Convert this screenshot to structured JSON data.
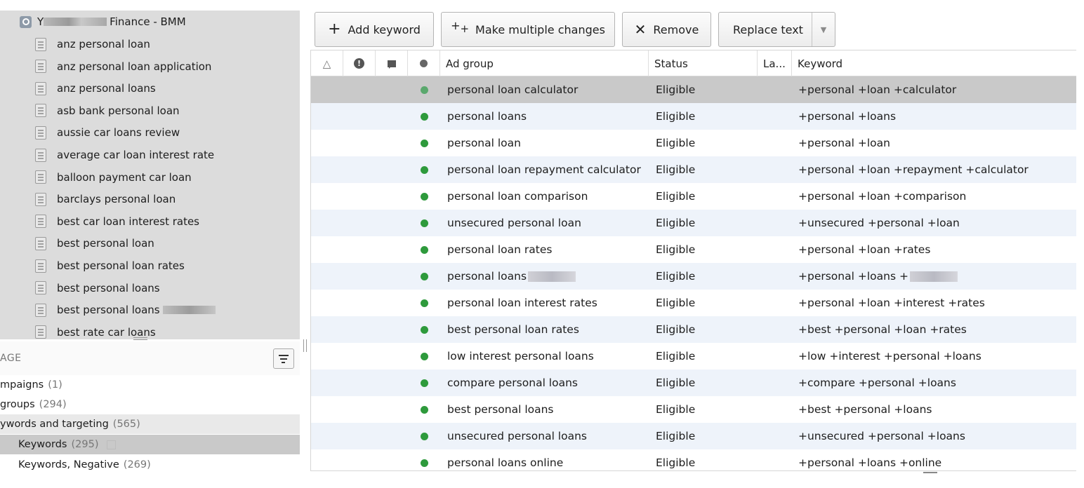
{
  "tree": {
    "root_label": "Finance - BMM",
    "root_prefix": "Y",
    "items": [
      {
        "label": "anz personal loan"
      },
      {
        "label": "anz personal loan application"
      },
      {
        "label": "anz personal loans"
      },
      {
        "label": "asb bank personal loan"
      },
      {
        "label": "aussie car loans review"
      },
      {
        "label": "average car loan interest rate"
      },
      {
        "label": "balloon payment car loan"
      },
      {
        "label": "barclays personal loan"
      },
      {
        "label": "best car loan interest rates"
      },
      {
        "label": "best personal loan"
      },
      {
        "label": "best personal loan rates"
      },
      {
        "label": "best personal loans"
      },
      {
        "label": "best personal loans"
      },
      {
        "label": "best rate car loans"
      }
    ]
  },
  "manage": {
    "title": "AGE",
    "rows": [
      {
        "label": "mpaigns",
        "count": "(1)"
      },
      {
        "label": "groups",
        "count": "(294)"
      },
      {
        "label": "ywords and targeting",
        "count": "(565)"
      },
      {
        "label": "Keywords",
        "count": "(295)"
      },
      {
        "label": "Keywords, Negative",
        "count": "(269)"
      }
    ]
  },
  "toolbar": {
    "add_keyword": "Add keyword",
    "multiple_changes": "Make multiple changes",
    "remove": "Remove",
    "replace_text": "Replace text"
  },
  "grid": {
    "headers": {
      "ad_group": "Ad group",
      "status": "Status",
      "label": "La...",
      "keyword": "Keyword"
    },
    "rows": [
      {
        "ad_group": "personal loan calculator",
        "status": "Eligible",
        "keyword": "+personal +loan +calculator"
      },
      {
        "ad_group": "personal loans",
        "status": "Eligible",
        "keyword": "+personal +loans"
      },
      {
        "ad_group": "personal loan",
        "status": "Eligible",
        "keyword": "+personal +loan"
      },
      {
        "ad_group": "personal loan repayment calculator",
        "status": "Eligible",
        "keyword": "+personal +loan +repayment +calculator"
      },
      {
        "ad_group": "personal loan comparison",
        "status": "Eligible",
        "keyword": "+personal +loan +comparison"
      },
      {
        "ad_group": "unsecured personal loan",
        "status": "Eligible",
        "keyword": "+unsecured +personal +loan"
      },
      {
        "ad_group": "personal loan rates",
        "status": "Eligible",
        "keyword": "+personal +loan +rates"
      },
      {
        "ad_group": "personal loans",
        "status": "Eligible",
        "keyword": "+personal +loans +"
      },
      {
        "ad_group": "personal loan interest rates",
        "status": "Eligible",
        "keyword": "+personal +loan +interest +rates"
      },
      {
        "ad_group": "best personal loan rates",
        "status": "Eligible",
        "keyword": "+best +personal +loan +rates"
      },
      {
        "ad_group": "low interest personal loans",
        "status": "Eligible",
        "keyword": "+low +interest +personal +loans"
      },
      {
        "ad_group": "compare personal loans",
        "status": "Eligible",
        "keyword": "+compare +personal +loans"
      },
      {
        "ad_group": "best personal loans",
        "status": "Eligible",
        "keyword": "+best +personal +loans"
      },
      {
        "ad_group": "unsecured personal loans",
        "status": "Eligible",
        "keyword": "+unsecured +personal +loans"
      },
      {
        "ad_group": "personal loans online",
        "status": "Eligible",
        "keyword": "+personal +loans +online"
      }
    ]
  },
  "colors": {
    "eligible_dot": "#2e9a3c",
    "selected_row": "#c9c9c9",
    "alt_row": "#eef3fa",
    "tree_bg": "#dcdcdc"
  }
}
